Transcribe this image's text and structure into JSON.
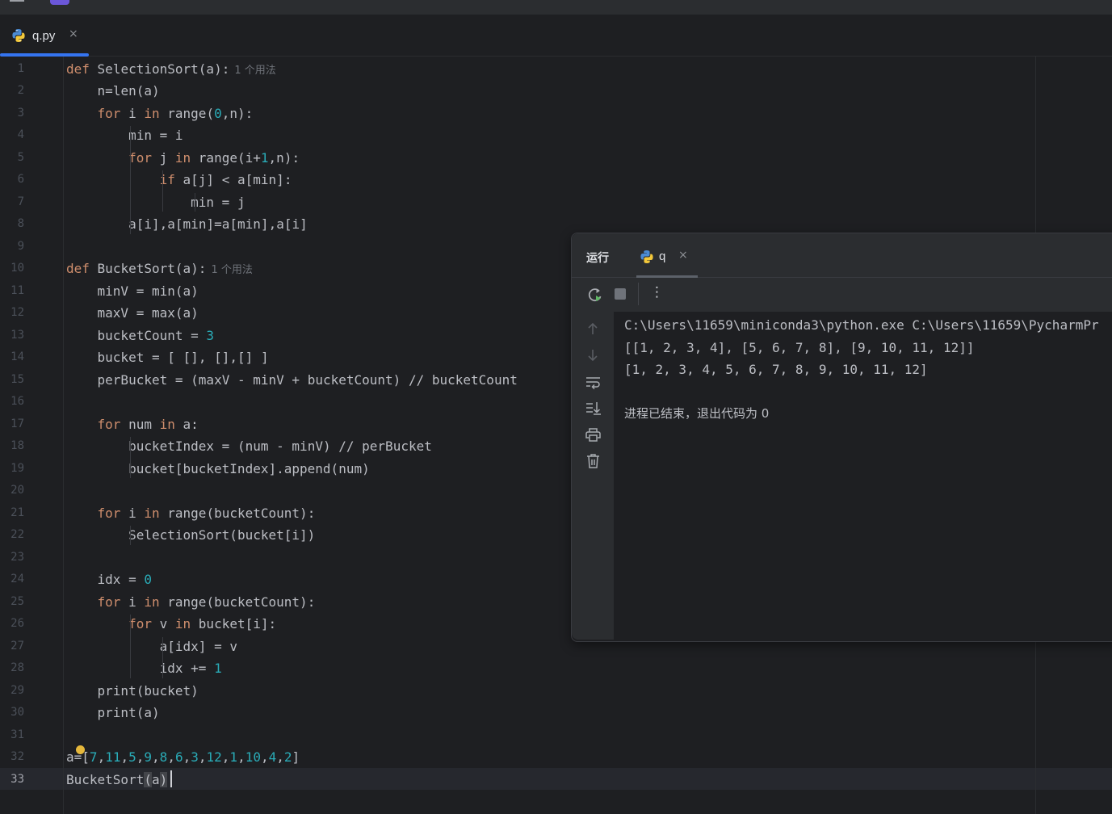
{
  "editor_tab": {
    "filename": "q.py",
    "close": "×"
  },
  "usage_hint": "1 个用法",
  "line_numbers": [
    "1",
    "2",
    "3",
    "4",
    "5",
    "6",
    "7",
    "8",
    "9",
    "10",
    "11",
    "12",
    "13",
    "14",
    "15",
    "16",
    "17",
    "18",
    "19",
    "20",
    "21",
    "22",
    "23",
    "24",
    "25",
    "26",
    "27",
    "28",
    "29",
    "30",
    "31",
    "32",
    "33"
  ],
  "current_line": 33,
  "code_lines": [
    "def SelectionSort(a):",
    "    n=len(a)",
    "    for i in range(0,n):",
    "        min = i",
    "        for j in range(i+1,n):",
    "            if a[j] < a[min]:",
    "                min = j",
    "        a[i],a[min]=a[min],a[i]",
    "",
    "def BucketSort(a):",
    "    minV = min(a)",
    "    maxV = max(a)",
    "    bucketCount = 3",
    "    bucket = [ [], [],[] ]",
    "    perBucket = (maxV - minV + bucketCount) // bucketCount",
    "",
    "    for num in a:",
    "        bucketIndex = (num - minV) // perBucket",
    "        bucket[bucketIndex].append(num)",
    "",
    "    for i in range(bucketCount):",
    "        SelectionSort(bucket[i])",
    "",
    "    idx = 0",
    "    for i in range(bucketCount):",
    "        for v in bucket[i]:",
    "            a[idx] = v",
    "            idx += 1",
    "    print(bucket)",
    "    print(a)",
    "",
    "a=[7,11,5,9,8,6,3,12,1,10,4,2]",
    "BucketSort(a)"
  ],
  "run_panel": {
    "title": "运行",
    "tab_name": "q",
    "tab_close": "×",
    "more_label": "⋮",
    "console_lines": [
      "C:\\Users\\11659\\miniconda3\\python.exe C:\\Users\\11659\\PycharmPr",
      "[[1, 2, 3, 4], [5, 6, 7, 8], [9, 10, 11, 12]]",
      "[1, 2, 3, 4, 5, 6, 7, 8, 9, 10, 11, 12]",
      "",
      "进程已结束，退出代码为 0"
    ]
  },
  "colors": {
    "keyword": "#cf8e6d",
    "number": "#2aacb8",
    "text": "#bcbec4",
    "hint": "#6f737a",
    "accent": "#3574f0"
  },
  "icons": [
    "menu-icon",
    "python-file-icon",
    "rerun-icon",
    "stop-icon",
    "more-icon",
    "scroll-up-icon",
    "scroll-down-icon",
    "soft-wrap-icon",
    "scroll-to-end-icon",
    "print-icon",
    "trash-icon",
    "lightbulb-icon"
  ]
}
